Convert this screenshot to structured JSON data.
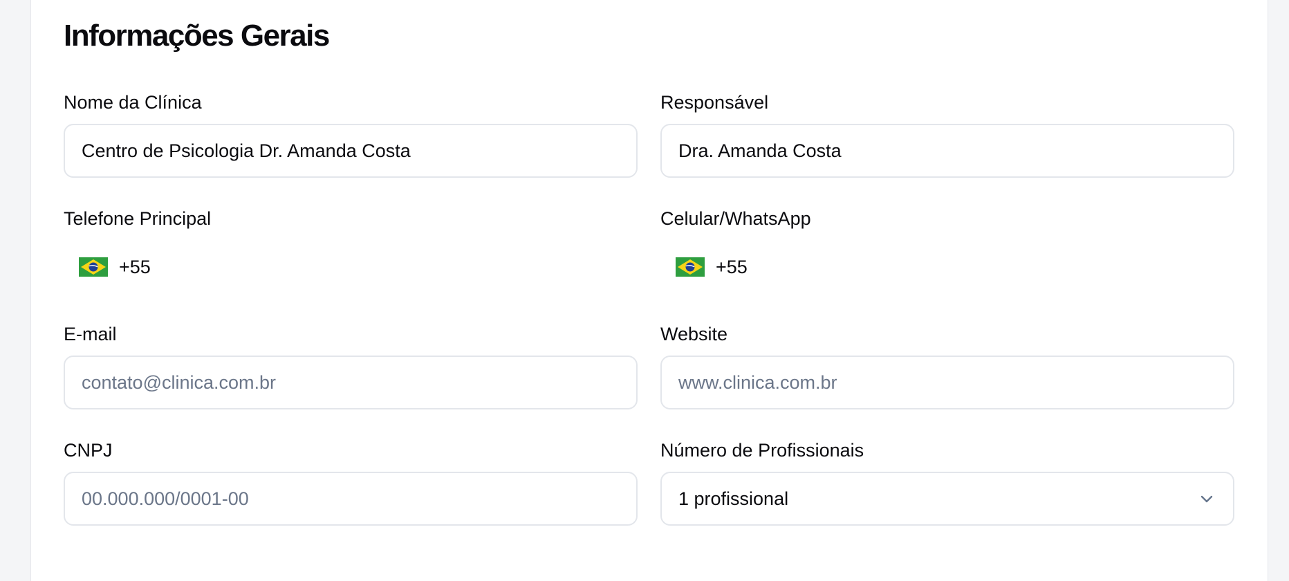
{
  "section": {
    "title": "Informações Gerais"
  },
  "fields": {
    "clinic_name": {
      "label": "Nome da Clínica",
      "value": "Centro de Psicologia Dr. Amanda Costa"
    },
    "responsible": {
      "label": "Responsável",
      "value": "Dra. Amanda Costa"
    },
    "main_phone": {
      "label": "Telefone Principal",
      "country_code": "+55",
      "flag": "brazil-flag-icon"
    },
    "mobile_whatsapp": {
      "label": "Celular/WhatsApp",
      "country_code": "+55",
      "flag": "brazil-flag-icon"
    },
    "email": {
      "label": "E-mail",
      "value": "",
      "placeholder": "contato@clinica.com.br"
    },
    "website": {
      "label": "Website",
      "value": "",
      "placeholder": "www.clinica.com.br"
    },
    "cnpj": {
      "label": "CNPJ",
      "value": "",
      "placeholder": "00.000.000/0001-00"
    },
    "professionals_count": {
      "label": "Número de Profissionais",
      "selected": "1 profissional",
      "icon": "chevron-down-icon"
    }
  },
  "colors": {
    "page_background": "#f4f5f7",
    "card_background": "#ffffff",
    "input_border": "#e3e6eb",
    "text": "#0b0b0f",
    "placeholder": "#6b7689",
    "flag_green": "#2e9e3f",
    "flag_yellow": "#f7d417",
    "flag_blue": "#1f3f94"
  }
}
